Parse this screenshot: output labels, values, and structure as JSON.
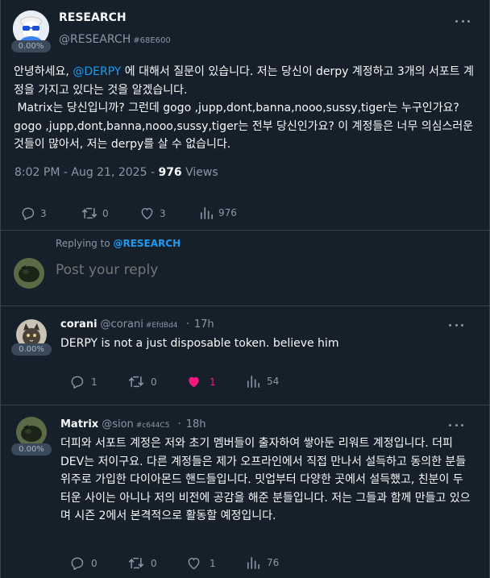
{
  "main_post": {
    "author_name": "RESEARCH",
    "handle": "@RESEARCH",
    "tag": "#68E600",
    "badge": "0.00%",
    "body_prefix": "안녕하세요, ",
    "mention": "@DERPY",
    "body_rest": " 에 대해서 질문이 있습니다. 저는 당신이 derpy 계정하고 3개의 서포트 계정을 가지고 있다는 것을 알겠습니다.\n Matrix는 당신입니까? 그런데 gogo ,jupp,dont,banna,nooo,sussy,tiger는 누구인가요? gogo ,jupp,dont,banna,nooo,sussy,tiger는 전부 당신인가요? 이 계정들은 너무 의심스러운 것들이 많아서, 저는 derpy를 살 수 없습니다.",
    "time": "8:02 PM - Aug 21, 2025 - ",
    "views_count": "976",
    "views_label": " Views",
    "stats": {
      "replies": "3",
      "reposts": "0",
      "likes": "3",
      "views": "976"
    }
  },
  "reply_box": {
    "replying_prefix": "Replying to ",
    "replying_to": "@RESEARCH",
    "placeholder": "Post your reply"
  },
  "comments": [
    {
      "name": "corani",
      "handle": "@corani",
      "tag": "#EfdBd4",
      "sep": "·",
      "age": "17h",
      "badge": "0.00%",
      "text": "DERPY is not a just disposable token. believe him",
      "stats": {
        "replies": "1",
        "reposts": "0",
        "likes": "1",
        "views": "54"
      }
    },
    {
      "name": "Matrix",
      "handle": "@sion",
      "tag": "#c644C5",
      "sep": "·",
      "age": "18h",
      "badge": "0.00%",
      "text": "더피와 서포트 계정은 저와 초기 멤버들이 출자하여 쌓아둔 리워트 계정입니다. 더피 DEV는 저이구요. 다른 계정들은 제가 오프라인에서 직접 만나서 설득하고 동의한 분들 위주로 가입한 다이아몬드 핸드들입니다. 밋업부터 다양한 곳에서 설득했고, 친분이 두터운 사이는 아니나 저의 비전에 공감을 해준 분들입니다. 저는 그들과 함께 만들고 있으며 시즌 2에서 본격적으로 활동할 예정입니다.",
      "stats": {
        "replies": "0",
        "reposts": "0",
        "likes": "1",
        "views": "76"
      }
    }
  ],
  "icons": {
    "reply": "reply-icon",
    "repost": "repost-icon",
    "like": "heart-icon",
    "views": "views-icon",
    "more": "more-icon"
  },
  "colors": {
    "background": "#15202b",
    "accent": "#1d9bf0",
    "like": "#f91880",
    "muted": "#8b98a5"
  }
}
